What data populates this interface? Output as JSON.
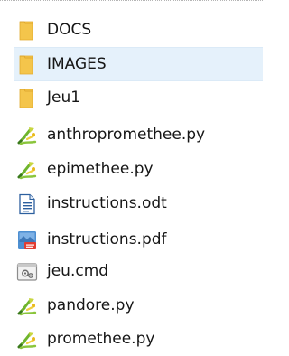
{
  "explorer": {
    "items": [
      {
        "name": "DOCS",
        "type": "folder",
        "icon": "folder-icon",
        "selected": false
      },
      {
        "name": "IMAGES",
        "type": "folder",
        "icon": "folder-icon",
        "selected": true
      },
      {
        "name": "Jeu1",
        "type": "folder",
        "icon": "folder-icon",
        "selected": false
      },
      {
        "name": "anthropromethee.py",
        "type": "python",
        "icon": "python-file-icon",
        "selected": false
      },
      {
        "name": "epimethee.py",
        "type": "python",
        "icon": "python-file-icon",
        "selected": false
      },
      {
        "name": "instructions.odt",
        "type": "document",
        "icon": "text-document-icon",
        "selected": false
      },
      {
        "name": "instructions.pdf",
        "type": "pdf",
        "icon": "pdf-file-icon",
        "selected": false
      },
      {
        "name": "jeu.cmd",
        "type": "command",
        "icon": "command-file-icon",
        "selected": false
      },
      {
        "name": "pandore.py",
        "type": "python",
        "icon": "python-file-icon",
        "selected": false
      },
      {
        "name": "promethee.py",
        "type": "python",
        "icon": "python-file-icon",
        "selected": false
      }
    ]
  },
  "colors": {
    "selection_bg": "#e5f1fb",
    "folder_yellow": "#f6c343",
    "text": "#161616"
  }
}
